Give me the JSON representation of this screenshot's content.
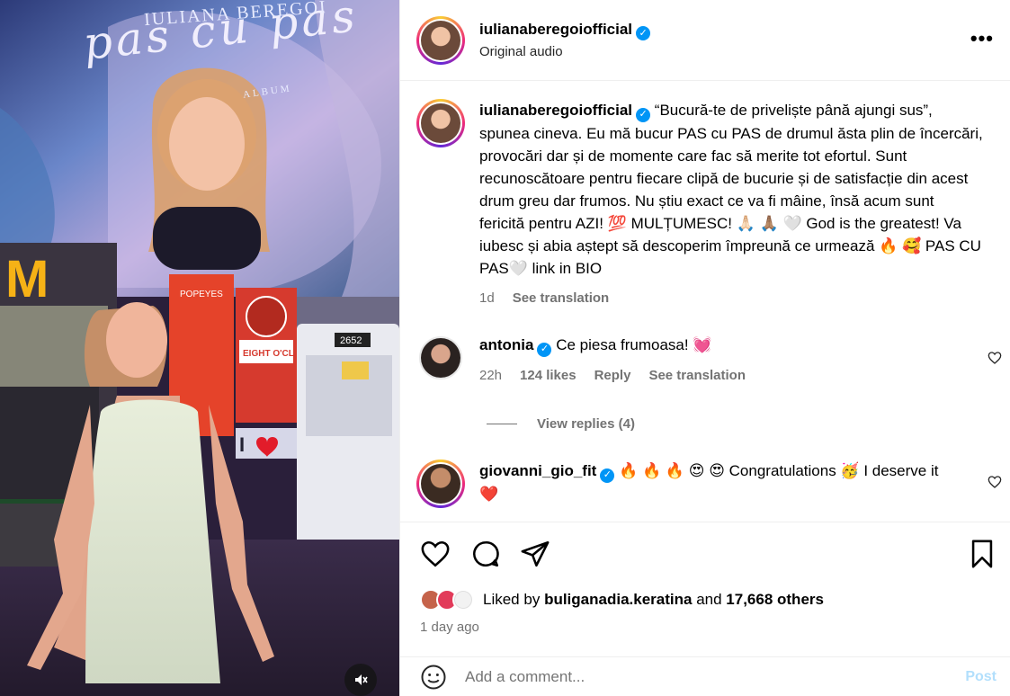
{
  "media": {
    "billboard_name": "IULIANA BEREGOI",
    "billboard_script": "pas cu pas",
    "billboard_album": "ALBUM",
    "sign_popeyes": "POPEYES",
    "sign_eight": "EIGHT O'CLOCK",
    "sign_bus": "2652",
    "sign_heart": "I ♥ N",
    "mute_icon": "muted-speaker-icon"
  },
  "header": {
    "username": "iulianaberegoiofficial",
    "subtitle": "Original audio",
    "more_icon": "•••"
  },
  "caption": {
    "username": "iulianaberegoiofficial",
    "text": "“Bucură-te de priveliște până ajungi sus”, spunea cineva. Eu mă bucur PAS cu PAS de drumul ăsta plin de încercări, provocări dar și de momente care fac să merite tot efortul. Sunt recunoscătoare pentru fiecare clipă de bucurie și de satisfacție din acest drum greu dar frumos. Nu știu exact ce va fi mâine, însă acum sunt fericită pentru AZI! 💯 MULȚUMESC! 🙏🏻 🙏🏽 🤍 God is the greatest! Va iubesc și abia aștept să descoperim împreună ce urmează 🔥 🥰 PAS CU PAS🤍 link in BIO",
    "time": "1d",
    "see_translation": "See translation"
  },
  "comments": [
    {
      "username": "antonia",
      "text": "Ce piesa frumoasa! 💓",
      "time": "22h",
      "likes": "124 likes",
      "reply": "Reply",
      "see_translation": "See translation",
      "view_replies": "View replies (4)"
    },
    {
      "username": "giovanni_gio_fit",
      "text": "🔥 🔥 🔥 😍 😍 Congratulations 🥳 I deserve it ❤️"
    }
  ],
  "actions": {
    "liked_by_prefix": "Liked by",
    "liked_by_user": "buliganadia.keratina",
    "liked_by_and": "and",
    "liked_by_others": "17,668 others",
    "time_ago": "1 day ago"
  },
  "composer": {
    "placeholder": "Add a comment...",
    "post_label": "Post"
  },
  "colors": {
    "verified": "#0095f6",
    "post_disabled": "#b2dffc",
    "muted_text": "#737373"
  }
}
